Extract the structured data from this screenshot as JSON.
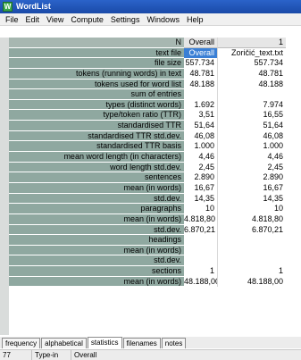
{
  "window": {
    "title": "WordList"
  },
  "menu": [
    "File",
    "Edit",
    "View",
    "Compute",
    "Settings",
    "Windows",
    "Help"
  ],
  "table": {
    "header": {
      "label": "N",
      "overall": "Overall",
      "file": "1"
    },
    "rows": [
      {
        "label": "text file",
        "overall": "Overall",
        "file": "Zoričić_text.txt",
        "selected": true
      },
      {
        "label": "file size",
        "overall": "557.734",
        "file": "557.734"
      },
      {
        "label": "tokens (running words) in text",
        "overall": "48.781",
        "file": "48.781"
      },
      {
        "label": "tokens used for word list",
        "overall": "48.188",
        "file": "48.188"
      },
      {
        "label": "sum of entries",
        "overall": "",
        "file": ""
      },
      {
        "label": "types (distinct words)",
        "overall": "1.692",
        "file": "7.974"
      },
      {
        "label": "type/token ratio (TTR)",
        "overall": "3,51",
        "file": "16,55"
      },
      {
        "label": "standardised TTR",
        "overall": "51,64",
        "file": "51,64"
      },
      {
        "label": "standardised TTR std.dev.",
        "overall": "46,08",
        "file": "46,08"
      },
      {
        "label": "standardised TTR basis",
        "overall": "1.000",
        "file": "1.000"
      },
      {
        "label": "mean word length (in characters)",
        "overall": "4,46",
        "file": "4,46"
      },
      {
        "label": "word length std.dev.",
        "overall": "2,45",
        "file": "2,45"
      },
      {
        "label": "sentences",
        "overall": "2.890",
        "file": "2.890"
      },
      {
        "label": "mean (in words)",
        "overall": "16,67",
        "file": "16,67"
      },
      {
        "label": "std.dev.",
        "overall": "14,35",
        "file": "14,35"
      },
      {
        "label": "paragraphs",
        "overall": "10",
        "file": "10"
      },
      {
        "label": "mean (in words)",
        "overall": "4.818,80",
        "file": "4.818,80"
      },
      {
        "label": "std.dev.",
        "overall": "6.870,21",
        "file": "6.870,21"
      },
      {
        "label": "headings",
        "overall": "",
        "file": ""
      },
      {
        "label": "mean (in words)",
        "overall": "",
        "file": ""
      },
      {
        "label": "std.dev.",
        "overall": "",
        "file": ""
      },
      {
        "label": "sections",
        "overall": "1",
        "file": "1"
      },
      {
        "label": "mean (in words)",
        "overall": "48.188,00",
        "file": "48.188,00"
      }
    ]
  },
  "tabs": [
    {
      "label": "frequency",
      "active": false
    },
    {
      "label": "alphabetical",
      "active": false
    },
    {
      "label": "statistics",
      "active": true
    },
    {
      "label": "filenames",
      "active": false
    },
    {
      "label": "notes",
      "active": false
    }
  ],
  "status": {
    "count": "77",
    "mode": "Type-in",
    "value": "Overall"
  }
}
